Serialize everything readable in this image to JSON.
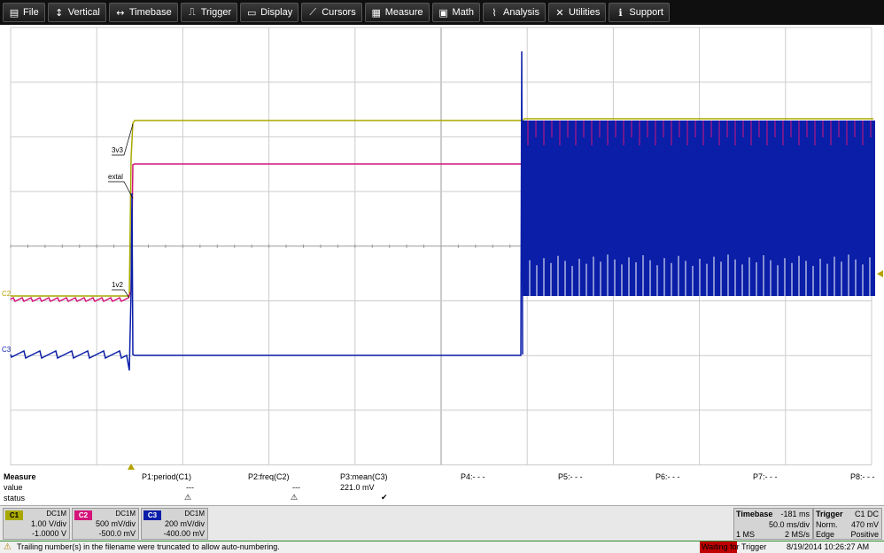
{
  "menu": [
    {
      "label": "File",
      "icon": "file-icon",
      "glyph": "▤"
    },
    {
      "label": "Vertical",
      "icon": "vertical-icon",
      "glyph": "↕"
    },
    {
      "label": "Timebase",
      "icon": "timebase-icon",
      "glyph": "↔"
    },
    {
      "label": "Trigger",
      "icon": "trigger-icon",
      "glyph": "⎍"
    },
    {
      "label": "Display",
      "icon": "display-icon",
      "glyph": "▭"
    },
    {
      "label": "Cursors",
      "icon": "cursors-icon",
      "glyph": "⟋"
    },
    {
      "label": "Measure",
      "icon": "measure-icon",
      "glyph": "▦"
    },
    {
      "label": "Math",
      "icon": "math-icon",
      "glyph": "▣"
    },
    {
      "label": "Analysis",
      "icon": "analysis-icon",
      "glyph": "⌇"
    },
    {
      "label": "Utilities",
      "icon": "utilities-icon",
      "glyph": "✕"
    },
    {
      "label": "Support",
      "icon": "support-icon",
      "glyph": "ℹ"
    }
  ],
  "waveform_labels": {
    "v3v3": "3v3",
    "extal": "extal",
    "v1v2": "1v2"
  },
  "channel_markers": {
    "c2": "C2",
    "c3": "C3"
  },
  "colors": {
    "c1": "#a8a800",
    "c2": "#d4147a",
    "c3": "#0a1ea8",
    "grid": "#cccccc",
    "axis": "#999999",
    "trigger": "#b5a400"
  },
  "measure": {
    "title": "Measure",
    "row_value": "value",
    "row_status": "status",
    "params": [
      {
        "name": "P1:period(C1)",
        "value": "---",
        "status": "warn"
      },
      {
        "name": "P2:freq(C2)",
        "value": "---",
        "status": "warn"
      },
      {
        "name": "P3:mean(C3)",
        "value": "221.0 mV",
        "status": "check"
      },
      {
        "name": "P4:- - -",
        "value": "",
        "status": ""
      },
      {
        "name": "P5:- - -",
        "value": "",
        "status": ""
      },
      {
        "name": "P6:- - -",
        "value": "",
        "status": ""
      },
      {
        "name": "P7:- - -",
        "value": "",
        "status": ""
      },
      {
        "name": "P8:- - -",
        "value": "",
        "status": ""
      }
    ]
  },
  "channels": [
    {
      "tag": "C1",
      "coupling": "DC1M",
      "scale": "1.00 V/div",
      "offset": "-1.0000 V"
    },
    {
      "tag": "C2",
      "coupling": "DC1M",
      "scale": "500 mV/div",
      "offset": "-500.0 mV"
    },
    {
      "tag": "C3",
      "coupling": "DC1M",
      "scale": "200 mV/div",
      "offset": "-400.00 mV"
    }
  ],
  "timebase": {
    "title": "Timebase",
    "delay": "-181 ms",
    "per_div": "50.0 ms/div",
    "points": "1 MS",
    "rate": "2 MS/s"
  },
  "trigger": {
    "title": "Trigger",
    "source": "C1 DC",
    "mode": "Norm.",
    "level": "470 mV",
    "type": "Edge",
    "slope": "Positive"
  },
  "status": {
    "message": "Trailing number(s) in the filename were truncated to allow auto-numbering.",
    "trigger_state": "Waiting for Trigger",
    "datetime": "8/19/2014 10:26:27 AM"
  }
}
